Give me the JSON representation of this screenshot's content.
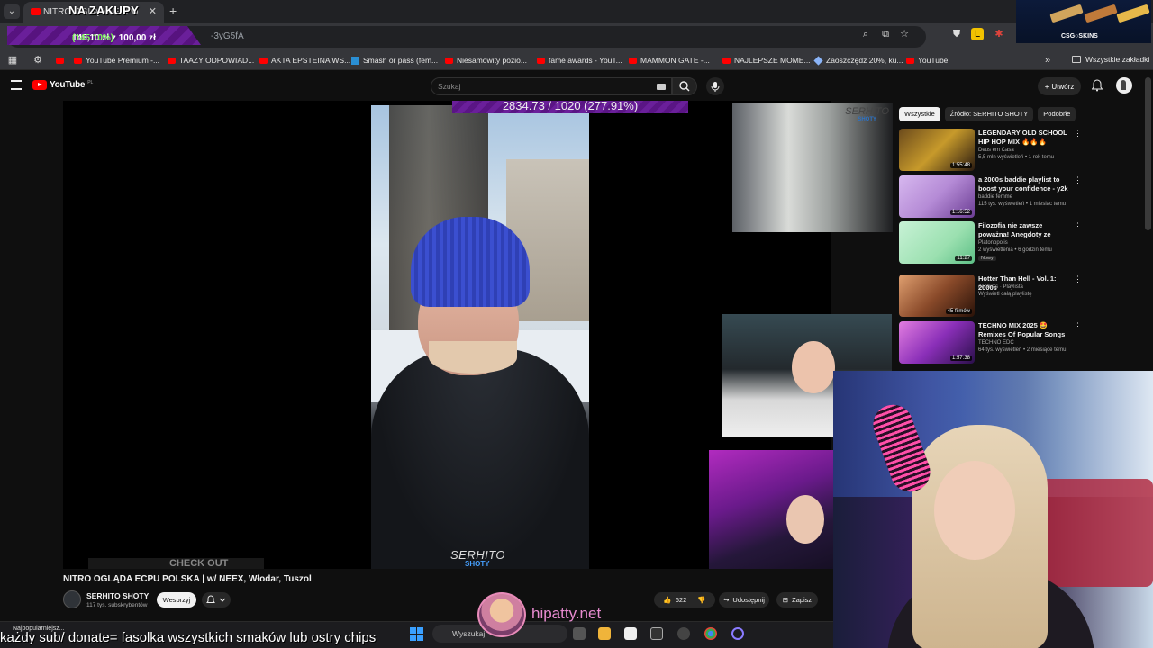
{
  "browser": {
    "tab_title": "NITRO OGLĄDA ECPU",
    "url_suffix": "-3yG5fA",
    "bookmarks": [
      {
        "label": "YouTube Premium -...",
        "icon": "youtube-icon"
      },
      {
        "label": "TAAZY ODPOWIAD...",
        "icon": "youtube-icon"
      },
      {
        "label": "AKTA EPSTEINA WS...",
        "icon": "youtube-icon"
      },
      {
        "label": "Smash or pass (fem...",
        "icon": "site-icon"
      },
      {
        "label": "Niesamowity pozio...",
        "icon": "youtube-icon"
      },
      {
        "label": "fame awards - YouT...",
        "icon": "youtube-icon"
      },
      {
        "label": "MAMMON GATE -...",
        "icon": "youtube-icon"
      },
      {
        "label": "NAJLEPSZE MOME...",
        "icon": "youtube-icon"
      },
      {
        "label": "Zaoszczędź 20%, ku...",
        "icon": "tag-icon"
      },
      {
        "label": "YouTube",
        "icon": "youtube-icon"
      }
    ],
    "all_bookmarks": "Wszystkie zakładki"
  },
  "overlay": {
    "title": "NA ZAKUPY",
    "budget_amount": "145,10 zł z 100,00 zł",
    "budget_percent": "(145.10%)",
    "goal_text": "2834.73 / 1020 (277.91%)",
    "sponsor": "CSG○SKINS",
    "site": "hipatty.net",
    "ticker": "każdy sub/ donate= fasolka wszystkich smaków lub ostry chips"
  },
  "youtube": {
    "logo": "YouTube",
    "logo_region": "PL",
    "search_placeholder": "Szukaj",
    "create_label": "Utwórz"
  },
  "video": {
    "title": "NITRO OGLĄDA ECPU POLSKA | w/ NEEX, Włodar, Tuszol",
    "watermark": "SERHITO",
    "watermark_sub": "SHOTY",
    "checkout": "CHECK OUT",
    "channel": "SERHITO SHOTY",
    "subs": "117 tys. subskrybentów",
    "support_label": "Wesprzyj",
    "likes": "622",
    "share_label": "Udostępnij",
    "save_label": "Zapisz"
  },
  "sidebar": {
    "chips": [
      "Wszystkie",
      "Źródło: SERHITO SHOTY",
      "Podobne"
    ],
    "items": [
      {
        "title": "LEGENDARY OLD SCHOOL HIP HOP MIX 🔥🔥🔥 Snoop Dog...",
        "channel": "Deus em Casa",
        "meta": "5,5 mln wyświetleń • 1 rok temu",
        "duration": "1:55:48",
        "thumb": "#c79a2b"
      },
      {
        "title": "a 2000s baddie playlist to boost your confidence - y2k playlist",
        "channel": "baddie femme",
        "meta": "115 tys. wyświetleń • 1 miesiąc temu",
        "duration": "1:16:52",
        "thumb": "#b58bd6"
      },
      {
        "title": "Filozofia nie zawsze poważna! Anegdoty ze świata filozofii",
        "channel": "Platonopolis",
        "meta": "2 wyświetlenia • 6 godzin temu",
        "duration": "11:27",
        "badge": "Nowy",
        "thumb": "#9be0b0"
      },
      {
        "title": "Hotter Than Hell - Vol. 1: 2000s",
        "channel": "debbie's · Playlista",
        "meta": "Wyświetl całą playlistę",
        "duration": "45 filmów",
        "thumb": "#8a4a2a"
      },
      {
        "title": "TECHNO MIX 2025 🤩 Remixes Of Popular Songs 💜...",
        "channel": "TECHNO EDC",
        "meta": "64 tys. wyświetleń • 2 miesiące temu",
        "duration": "1:57:38",
        "thumb": "#8a2fb8"
      }
    ]
  },
  "taskbar": {
    "weather": "Najpopularniejsz...",
    "search": "Wyszukaj"
  }
}
